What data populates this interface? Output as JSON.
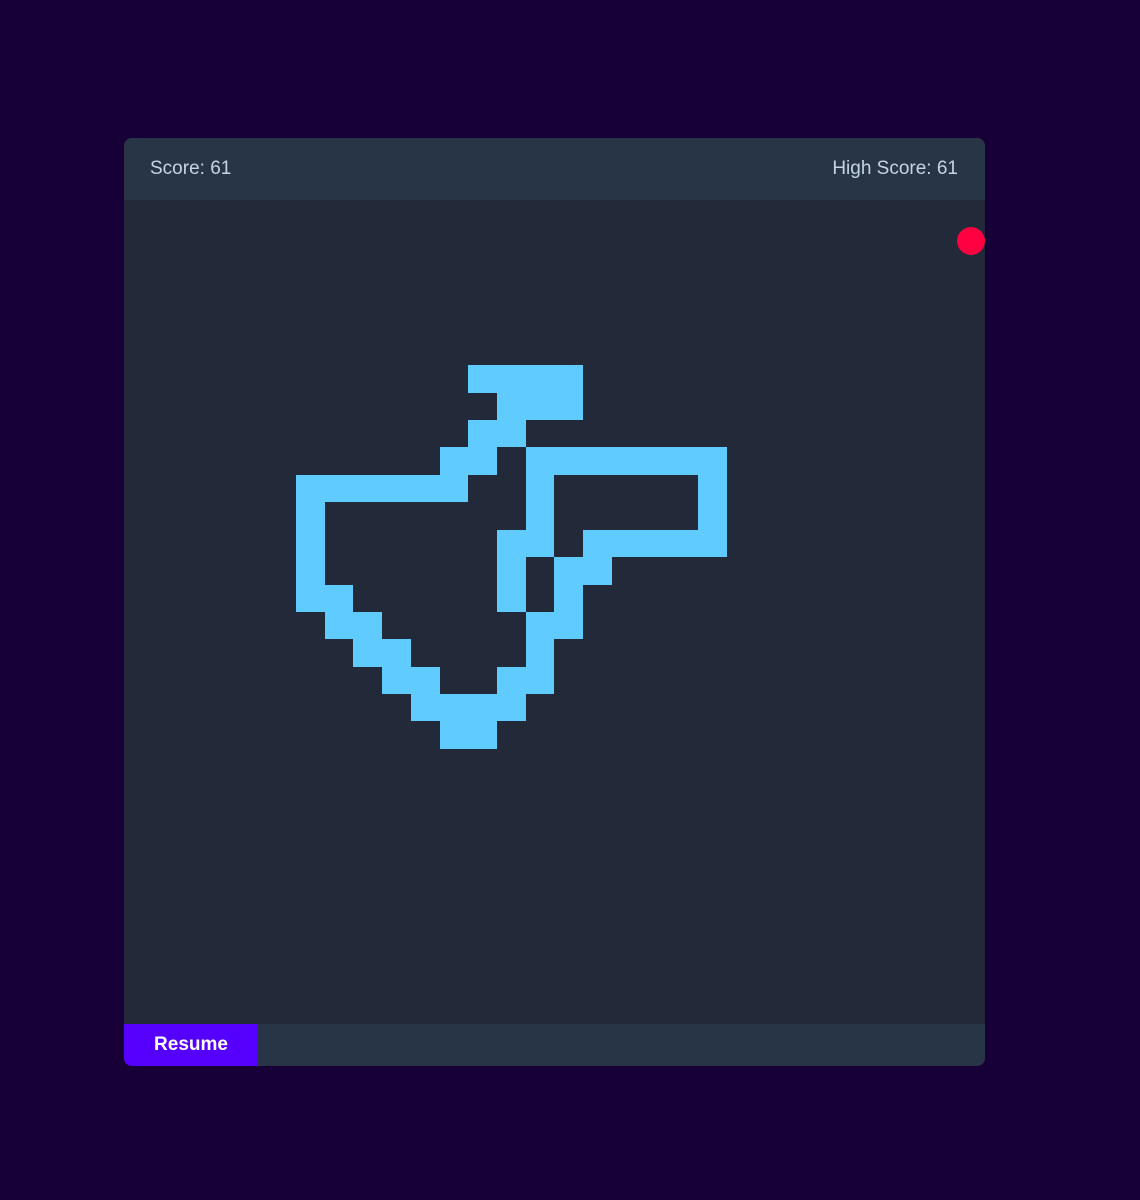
{
  "header": {
    "score_text": "Score: 61",
    "high_score_text": "High Score: 61"
  },
  "controls": {
    "resume_label": "Resume"
  },
  "colors": {
    "background": "#170038",
    "board": "#222a3a",
    "bars": "#283546",
    "snake": "#60cbff",
    "food": "#ff0040",
    "button": "#5500ff"
  }
}
